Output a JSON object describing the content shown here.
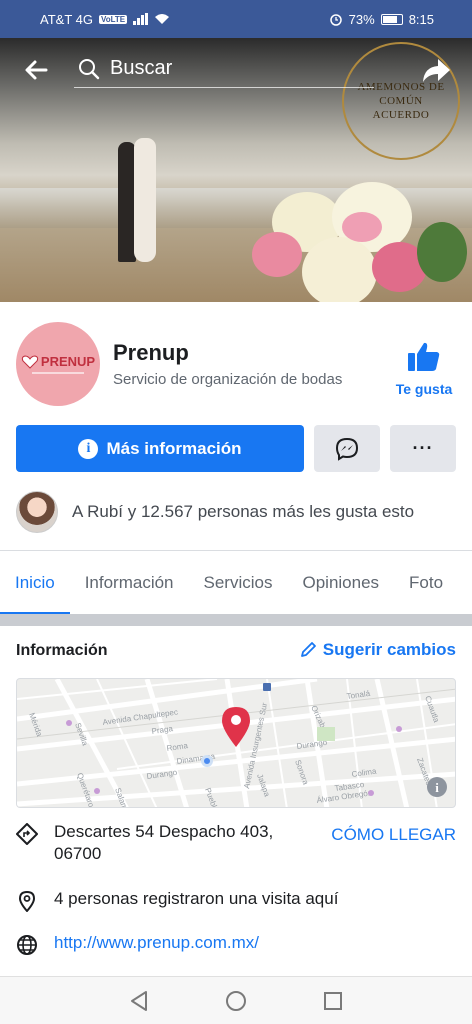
{
  "status_bar": {
    "carrier": "AT&T 4G",
    "volte": "VoLTE",
    "battery": "73%",
    "time": "8:15",
    "icons": [
      "signal-icon",
      "wifi-icon",
      "alarm-icon",
      "battery-icon"
    ]
  },
  "cover": {
    "seal_text": "AMEMONOS DE COMÚN ACUERDO"
  },
  "top_nav": {
    "search_placeholder": "Buscar"
  },
  "page": {
    "logo_text": "PRENUP",
    "name": "Prenup",
    "category": "Servicio de organización de bodas",
    "like_label": "Te gusta"
  },
  "actions": {
    "more_info_label": "Más información",
    "info_glyph": "i",
    "more_glyph": "···"
  },
  "likes": {
    "text": "A Rubí y 12.567 personas más les gusta esto"
  },
  "tabs": [
    {
      "label": "Inicio",
      "active": true
    },
    {
      "label": "Información",
      "active": false
    },
    {
      "label": "Servicios",
      "active": false
    },
    {
      "label": "Opiniones",
      "active": false
    },
    {
      "label": "Foto",
      "active": false
    }
  ],
  "info": {
    "heading": "Información",
    "suggest_label": "Sugerir cambios",
    "map_labels": [
      "Avenida Chapultepec",
      "Roma",
      "Praga",
      "Sevilla",
      "Dinamarca",
      "Durango",
      "Salamanca",
      "Orizaba",
      "Avenida Insurgentes Sur",
      "Sonora",
      "Durango",
      "Puebla",
      "Zacatecas",
      "Tabasco",
      "Álvaro Obregón",
      "Colima",
      "Jalapa",
      "Mérida",
      "Tonalá",
      "Cuautla",
      "Querétaro"
    ],
    "address": "Descartes 54 Despacho 403, 06700",
    "directions_label": "CÓMO LLEGAR",
    "visits": "4 personas registraron una visita aquí",
    "website": "http://www.prenup.com.mx/"
  },
  "colors": {
    "accent": "#1877f2",
    "status_bar": "#3b5998",
    "logo_bg": "#f0a6ad",
    "map_pin": "#e0334a"
  }
}
